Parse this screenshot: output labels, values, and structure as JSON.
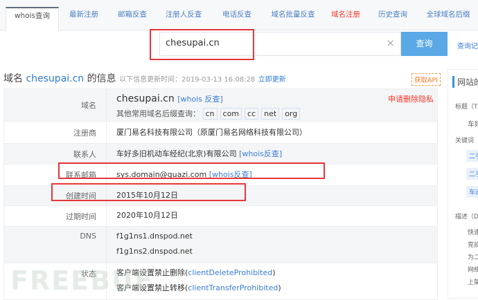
{
  "tabs": [
    "whois查询",
    "最新注册",
    "邮箱反查",
    "注册人反查",
    "电话反查",
    "域名批量反查",
    "域名注册",
    "历史查询",
    "全球域名后缀"
  ],
  "search": {
    "value": "chesupai.cn",
    "clear": "×",
    "button": "查询",
    "history": "查询记录"
  },
  "header": {
    "prefix": "域名",
    "domain": "chesupai.cn",
    "suffix": "的信息",
    "update_text": "以下信息更新时间：2019-03-13 16:08:28",
    "update_link": "立即更新",
    "api": "获取API"
  },
  "rows": {
    "domain": {
      "label": "域名",
      "value": "chesupai.cn",
      "link": "[whois 反查]",
      "other": "其他常用域名后缀查询：",
      "suffixes": [
        "cn",
        "com",
        "cc",
        "net",
        "org"
      ],
      "privacy": "申请删除隐私"
    },
    "registrar": {
      "label": "注册商",
      "value": "厦门易名科技有限公司（原厦门易名网络科技有限公司）"
    },
    "contact": {
      "label": "联系人",
      "value": "车好多旧机动车经纪(北京)有限公司",
      "link": "[whois反查]"
    },
    "email": {
      "label": "联系邮箱",
      "value": "sys.domain@guazi.com",
      "link": "[whois反查]"
    },
    "created": {
      "label": "创建时间",
      "value": "2015年10月12日"
    },
    "expires": {
      "label": "过期时间",
      "value": "2020年10月12日"
    },
    "dns": {
      "label": "DNS",
      "values": [
        "f1g1ns1.dnspod.net",
        "f1g1ns2.dnspod.net"
      ]
    },
    "status": {
      "label": "状态",
      "values": [
        {
          "text": "客户端设置禁止删除(",
          "code": "clientDeleteProhibited",
          "end": ")"
        },
        {
          "text": "客户端设置禁止转移(",
          "code": "clientTransferProhibited",
          "end": ")"
        }
      ]
    }
  },
  "side": {
    "title": "网站的",
    "t_label": "标题（Ti",
    "t_val": "车好",
    "k_label": "关键词（",
    "kws": [
      "二手",
      "二手",
      "车迹"
    ],
    "d_label": "描述（D",
    "desc": [
      "快速",
      "竞拍",
      "为二",
      "网络",
      "上架"
    ]
  },
  "watermark": "FREEBUF"
}
